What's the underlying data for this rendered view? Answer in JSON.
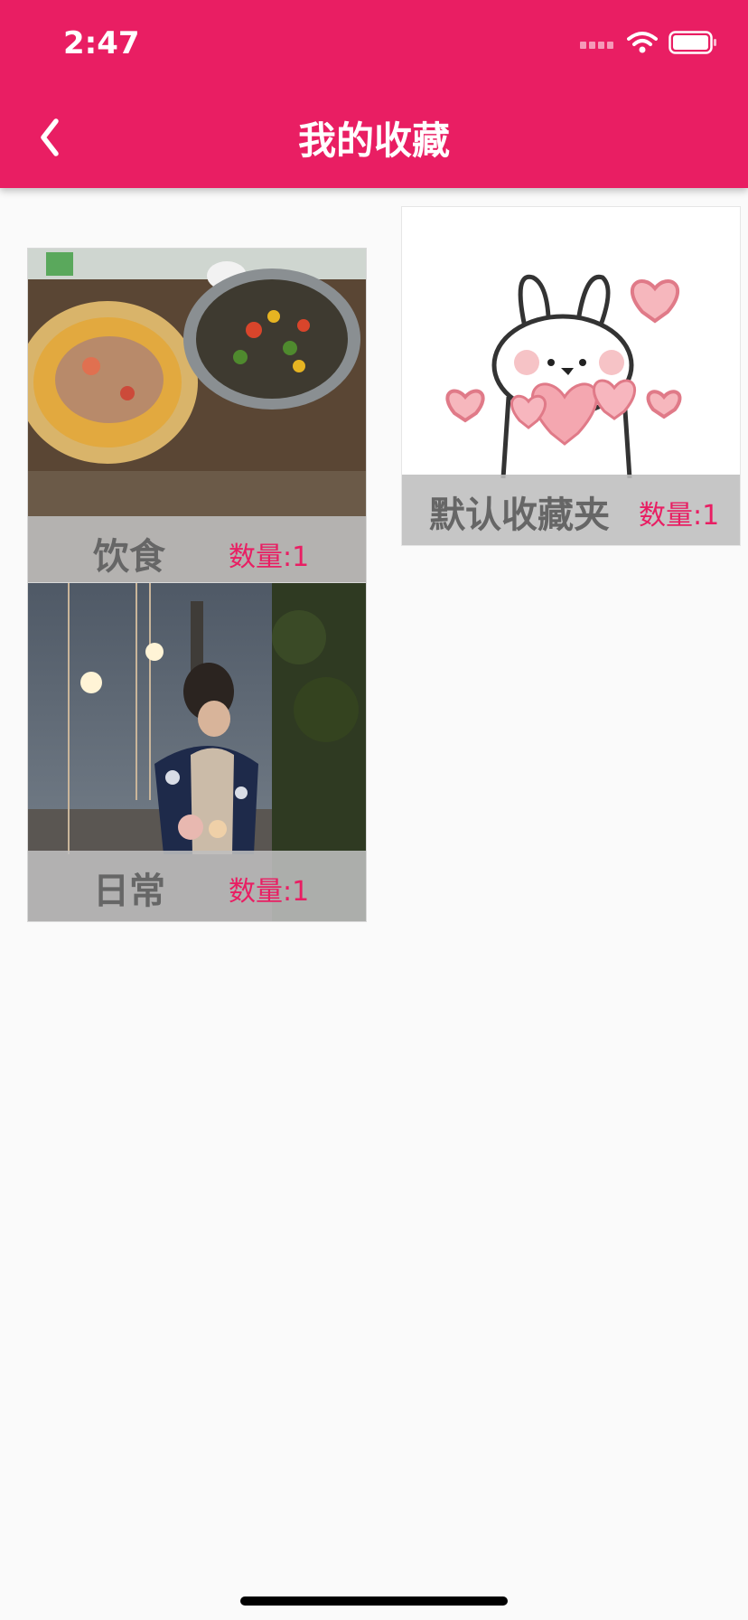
{
  "status_bar": {
    "time": "2:47"
  },
  "header": {
    "title": "我的收藏",
    "back_icon": "chevron-left-icon"
  },
  "colors": {
    "accent": "#e91e63",
    "card_overlay": "#bebebe",
    "name_text": "#666666"
  },
  "collections": [
    {
      "name": "饮食",
      "count": "数量:1",
      "image": "food-dishes-photo"
    },
    {
      "name": "默认收藏夹",
      "count": "数量:1",
      "image": "bunny-hearts-sticker"
    },
    {
      "name": "日常",
      "count": "数量:1",
      "image": "night-portrait-photo"
    }
  ]
}
